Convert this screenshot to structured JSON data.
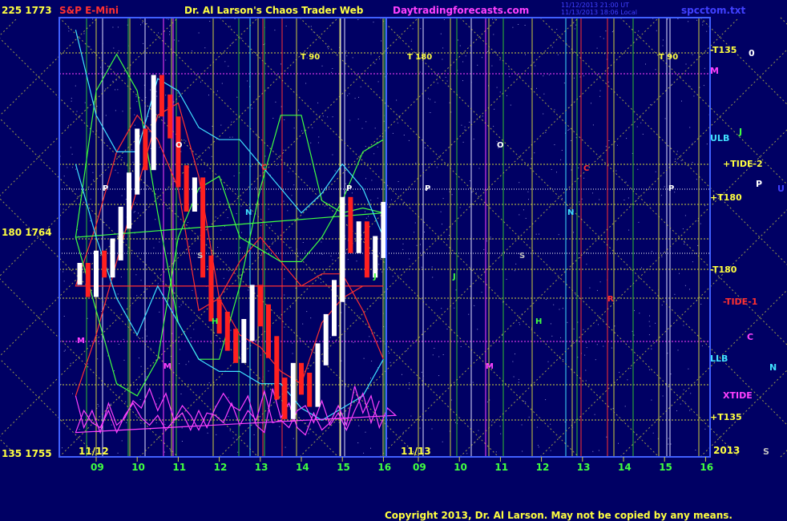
{
  "header": {
    "symbol": "S&P E-Mini",
    "title": "Dr. Al Larson's Chaos Trader Web",
    "site": "Daytradingforecasts.com",
    "file": "spcctom.txt",
    "stamp1": "11/12/2013 21:00 UT",
    "stamp2": "11/13/2013 18:06 Local"
  },
  "footer": {
    "copyright": "Copyright 2013, Dr. Al Larson. May not be copied by any means."
  },
  "left_axis": [
    {
      "label": "225  1773",
      "price": 1773
    },
    {
      "label": "180  1764",
      "price": 1764
    },
    {
      "label": "135  1755",
      "price": 1755
    }
  ],
  "right_labels": [
    {
      "text": "-T135",
      "color": "#ffff40"
    },
    {
      "text": "M",
      "color": "#ff40ff"
    },
    {
      "text": "ULB",
      "color": "#40e0ff"
    },
    {
      "text": "+TIDE-2",
      "color": "#ffff40"
    },
    {
      "text": "+T180",
      "color": "#ffff40"
    },
    {
      "text": "-T180",
      "color": "#ffff40"
    },
    {
      "text": "-TIDE-1",
      "color": "#ff3030"
    },
    {
      "text": "LLB",
      "color": "#40e0ff"
    },
    {
      "text": "XTIDE",
      "color": "#ff40ff"
    },
    {
      "text": "+T135",
      "color": "#ffff40"
    },
    {
      "text": "2013",
      "color": "#ffff40"
    }
  ],
  "side_letters": [
    {
      "text": "0",
      "color": "#ffffff"
    },
    {
      "text": "J",
      "color": "#40ff40"
    },
    {
      "text": "P",
      "color": "#ffffff"
    },
    {
      "text": "U",
      "color": "#4040ff"
    },
    {
      "text": "C",
      "color": "#ff40ff"
    },
    {
      "text": "N",
      "color": "#40e0ff"
    },
    {
      "text": "S",
      "color": "#c0c0c0"
    }
  ],
  "x_axis": {
    "hours": [
      "09",
      "10",
      "11",
      "12",
      "13",
      "14",
      "15",
      "16",
      "09",
      "10",
      "11",
      "12",
      "13",
      "14",
      "15",
      "16"
    ],
    "dates": [
      "11/12",
      "11/13"
    ]
  },
  "chart_annotations": [
    {
      "text": "T  90",
      "color": "#ffff40"
    },
    {
      "text": "T  180",
      "color": "#ffff40"
    },
    {
      "text": "T  90",
      "color": "#ffff40"
    },
    {
      "text": "P",
      "color": "#ffffff"
    },
    {
      "text": "O",
      "color": "#ffffff"
    },
    {
      "text": "C",
      "color": "#ff3030"
    },
    {
      "text": "N",
      "color": "#40e0ff"
    },
    {
      "text": "S",
      "color": "#c0c0c0"
    },
    {
      "text": "H",
      "color": "#40ff40"
    },
    {
      "text": "M",
      "color": "#ff40ff"
    },
    {
      "text": "J",
      "color": "#40ff40"
    },
    {
      "text": "P",
      "color": "#ffffff"
    },
    {
      "text": "P",
      "color": "#ffffff"
    },
    {
      "text": "O",
      "color": "#ffffff"
    },
    {
      "text": "C",
      "color": "#ff3030"
    },
    {
      "text": "N",
      "color": "#40e0ff"
    },
    {
      "text": "S",
      "color": "#c0c0c0"
    },
    {
      "text": "J",
      "color": "#40ff40"
    },
    {
      "text": "H",
      "color": "#40ff40"
    },
    {
      "text": "M",
      "color": "#ff40ff"
    },
    {
      "text": "P",
      "color": "#ffffff"
    },
    {
      "text": "M",
      "color": "#ff40ff"
    },
    {
      "text": "R",
      "color": "#ff3030"
    }
  ],
  "colors": {
    "background": "#000064",
    "plot_border": "#4060ff",
    "grid_yellow": "#d0d040",
    "grid_green": "#30c030",
    "title_red": "#ff3030",
    "title_site": "#ff40ff",
    "title_blue": "#4040ff",
    "price_up": "#ffffff",
    "price_down": "#ff2020"
  },
  "chart_data": {
    "type": "line",
    "title": "S&P E-Mini",
    "ylim": [
      1755,
      1773
    ],
    "y_ticks": [
      1773,
      1764,
      1755
    ],
    "x_ticks": [
      "09",
      "10",
      "11",
      "12",
      "13",
      "14",
      "15",
      "16"
    ],
    "series": [
      {
        "name": "S&P E-Mini",
        "color": "#ffffff",
        "x": [
          8.6,
          8.8,
          9.0,
          9.2,
          9.4,
          9.6,
          9.8,
          10.0,
          10.2,
          10.4,
          10.6,
          10.8,
          11.0,
          11.2,
          11.4,
          11.6,
          11.8,
          12.0,
          12.2,
          12.4,
          12.6,
          12.8,
          13.0,
          13.2,
          13.4,
          13.6,
          13.8,
          14.0,
          14.2,
          14.4,
          14.6,
          14.8,
          15.0,
          15.2,
          15.4,
          15.6,
          15.8,
          16.0
        ],
        "values": [
          1762.5,
          1762.0,
          1763.0,
          1762.8,
          1763.5,
          1764.8,
          1766.2,
          1768.0,
          1767.2,
          1770.2,
          1769.4,
          1768.5,
          1766.5,
          1765.5,
          1766.0,
          1762.8,
          1761.0,
          1760.5,
          1759.8,
          1759.3,
          1760.2,
          1761.6,
          1760.8,
          1759.5,
          1757.8,
          1757.0,
          1758.4,
          1758.0,
          1757.5,
          1759.2,
          1760.4,
          1761.8,
          1765.2,
          1763.8,
          1764.2,
          1762.8,
          1763.6,
          1765.0
        ]
      },
      {
        "name": "",
        "color": "#ff3030",
        "x": [
          8.5,
          9.0,
          9.5,
          10.0,
          10.5,
          11.0,
          11.5,
          12.0,
          12.5,
          13.0,
          13.5,
          14.0,
          14.5,
          15.0,
          15.5,
          16.0,
          16.5,
          17.0,
          17.5,
          18.0,
          18.5,
          19.0,
          19.5,
          20.0,
          20.5,
          21.0,
          21.5,
          22.0,
          22.5,
          23.0,
          23.5,
          24.0
        ],
        "values": [
          1757.5,
          1760.0,
          1763.0,
          1766.0,
          1769.0,
          1769.5,
          1766.5,
          1761.5,
          1760.0,
          1759.5,
          1758.5,
          1758.0,
          1760.5,
          1761.5,
          1762.0,
          1762.0,
          1762.0,
          1764.5,
          1767.5,
          1769.0,
          1768.0,
          1766.0,
          1761.0,
          1761.5,
          1763.0,
          1764.0,
          1763.0,
          1762.0,
          1762.5,
          1762.5,
          1761.0,
          1759.0
        ]
      },
      {
        "name": "",
        "color": "#40ff40",
        "x": [
          8.5,
          9.0,
          9.5,
          10.0,
          10.5,
          11.0,
          11.5,
          12.0,
          12.5,
          13.0,
          13.5,
          14.0,
          14.5,
          15.0,
          15.5,
          16.0,
          16.5,
          17.0,
          17.5,
          18.0,
          18.5,
          19.0,
          19.5,
          20.0,
          20.5,
          21.0,
          21.5,
          22.0,
          22.5,
          23.0,
          23.5,
          24.0
        ],
        "values": [
          1764.0,
          1770.0,
          1771.5,
          1770.0,
          1765.0,
          1760.5,
          1759.0,
          1759.0,
          1762.0,
          1766.0,
          1769.0,
          1769.0,
          1765.5,
          1765.0,
          1765.2,
          1765.0,
          1764.0,
          1761.0,
          1758.0,
          1757.5,
          1759.0,
          1764.0,
          1766.0,
          1766.5,
          1764.0,
          1763.5,
          1763.0,
          1763.0,
          1764.0,
          1765.5,
          1767.5,
          1768.0
        ]
      },
      {
        "name": "",
        "color": "#40e0ff",
        "x": [
          8.5,
          9.0,
          9.5,
          10.0,
          10.5,
          11.0,
          11.5,
          12.0,
          12.5,
          13.0,
          13.5,
          14.0,
          14.5,
          15.0,
          15.5,
          16.0
        ],
        "values": [
          1772.5,
          1769.0,
          1767.5,
          1767.5,
          1770.5,
          1770.0,
          1768.5,
          1768.0,
          1768.0,
          1767.0,
          1766.0,
          1765.0,
          1765.8,
          1767.0,
          1766.0,
          1764.0
        ]
      },
      {
        "name": "",
        "color": "#40e0ff",
        "x": [
          8.5,
          9.0,
          9.5,
          10.0,
          10.5,
          11.0,
          11.5,
          12.0,
          12.5,
          13.0,
          13.5,
          14.0,
          14.5,
          15.0,
          15.5,
          16.0
        ],
        "values": [
          1767.0,
          1764.0,
          1761.5,
          1760.0,
          1762.0,
          1760.5,
          1759.0,
          1758.5,
          1758.5,
          1758.0,
          1758.0,
          1757.0,
          1756.5,
          1757.0,
          1757.5,
          1759.0
        ]
      },
      {
        "name": "",
        "color": "#ff40ff",
        "x": [
          8.5,
          8.7,
          8.9,
          9.1,
          9.3,
          9.5,
          9.7,
          9.9,
          10.1,
          10.3,
          10.5,
          10.7,
          10.9,
          11.1,
          11.3,
          11.5,
          11.7,
          11.9,
          12.1,
          12.3,
          12.5,
          12.7,
          12.9,
          13.1,
          13.3,
          13.5,
          13.7,
          13.9,
          14.1,
          14.3,
          14.5,
          14.7,
          14.9,
          15.1,
          15.3,
          15.5,
          15.7,
          15.9,
          16.1,
          16.3,
          16.5,
          16.7,
          16.9,
          17.1,
          17.3,
          17.5,
          17.7,
          17.9,
          18.1,
          18.3,
          18.5,
          18.7,
          18.9,
          19.1,
          19.3,
          19.5,
          19.7,
          19.9,
          20.1,
          20.3,
          20.5,
          20.7,
          20.9,
          21.1,
          21.3,
          21.5,
          21.7,
          21.9,
          22.1,
          22.3,
          22.5,
          22.7,
          22.9,
          23.1,
          23.3,
          23.5,
          23.7,
          23.9
        ],
        "values": [
          1757.5,
          1756.2,
          1756.9,
          1756.0,
          1757.2,
          1756.3,
          1756.6,
          1757.3,
          1757.0,
          1757.8,
          1756.9,
          1757.6,
          1756.5,
          1756.8,
          1756.1,
          1756.9,
          1756.2,
          1757.0,
          1757.6,
          1757.1,
          1756.9,
          1757.5,
          1756.3,
          1756.0,
          1757.8,
          1756.6,
          1757.2,
          1756.2,
          1755.9,
          1756.8,
          1756.1,
          1756.4,
          1757.1,
          1756.3,
          1757.9,
          1756.8,
          1757.5,
          1756.2,
          1757.0,
          1756.7,
          1756.0,
          1756.9,
          1756.4,
          1756.2,
          1756.9,
          1756.0,
          1756.7,
          1757.2,
          1756.6,
          1756.3,
          1756.7,
          1756.1,
          1756.5,
          1757.1,
          1756.7,
          1756.1,
          1756.8,
          1756.7,
          1756.4,
          1757.2,
          1756.3,
          1756.9,
          1756.5,
          1757.7,
          1756.4,
          1756.5,
          1756.2,
          1756.9,
          1757.1,
          1756.4,
          1757.3,
          1756.3,
          1756.8,
          1756.1,
          1756.9,
          1757.6,
          1756.4,
          1757.3
        ]
      }
    ]
  }
}
